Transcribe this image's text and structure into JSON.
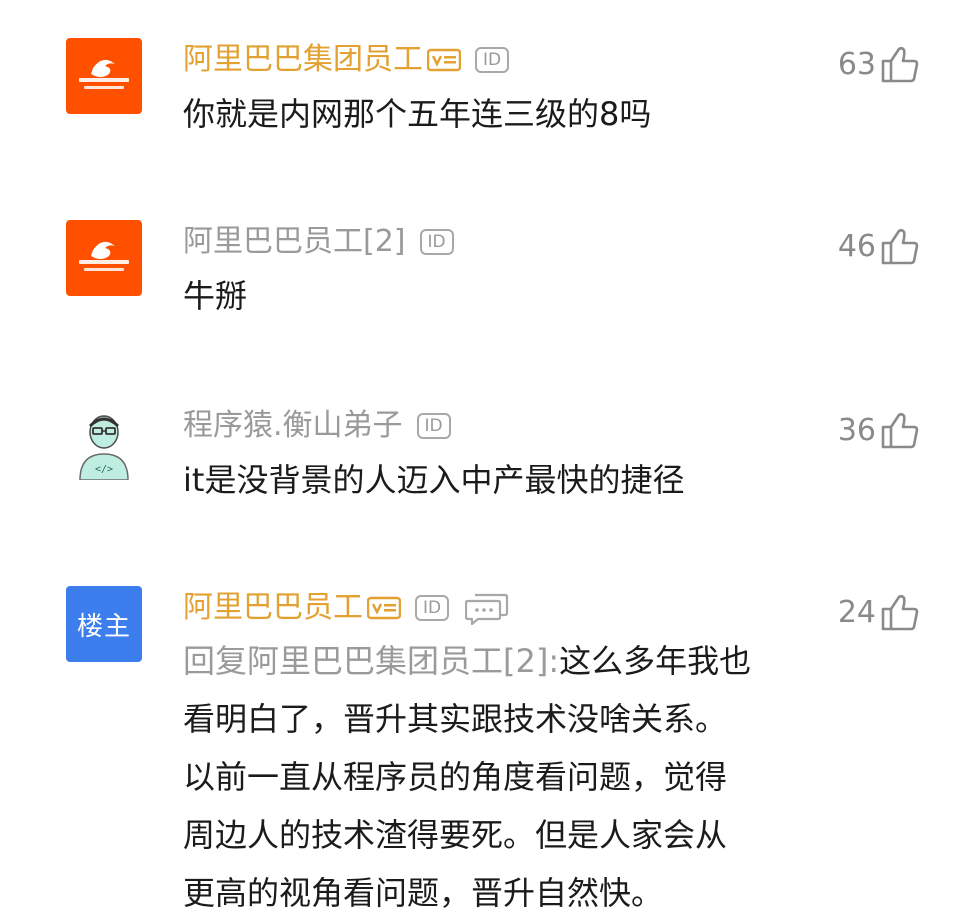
{
  "comments": [
    {
      "username": "阿里巴巴集团员工",
      "id_badge": "ID",
      "text": "你就是内网那个五年连三级的8吗",
      "likes": "63",
      "avatar": "alibaba-logo",
      "has_vip_badge": true
    },
    {
      "username": "阿里巴巴员工[2]",
      "id_badge": "ID",
      "text": "牛掰",
      "likes": "46",
      "avatar": "alibaba-logo"
    },
    {
      "username": "程序猿.衡山弟子",
      "id_badge": "ID",
      "text": "it是没背景的人迈入中产最快的捷径",
      "likes": "36",
      "avatar": "coder-avatar"
    },
    {
      "username": "阿里巴巴员工",
      "id_badge": "ID",
      "avatar_label": "楼主",
      "reply_prefix": "回复阿里巴巴集团员工[2]:",
      "text_lines": [
        "这么多年我也",
        "看明白了，晋升其实跟技术没啥关系。",
        "以前一直从程序员的角度看问题，觉得",
        "周边人的技术渣得要死。但是人家会从",
        "更高的视角看问题，晋升自然快。"
      ],
      "likes": "24",
      "has_vip_badge": true
    }
  ],
  "colors": {
    "username_gold": "#e2a130",
    "username_grey": "#9a9a9a",
    "alibaba_orange": "#ff5000",
    "owner_blue": "#3d7eef"
  }
}
